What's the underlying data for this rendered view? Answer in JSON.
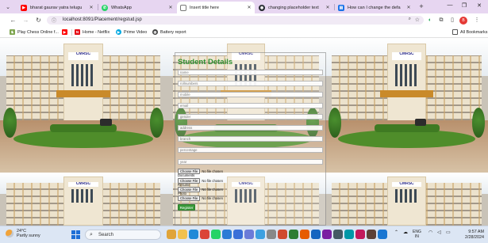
{
  "browser": {
    "tabs": [
      {
        "title": "bharat gaurav yatra telugu",
        "icon_color": "#ff0000",
        "active": false
      },
      {
        "title": "WhatsApp",
        "icon_color": "#25d366",
        "active": false
      },
      {
        "title": "Insert title here",
        "icon_color": "#6b6b6b",
        "active": true
      },
      {
        "title": "changing placeholder text",
        "icon_color": "#24292f",
        "active": false
      },
      {
        "title": "How can I change the defa",
        "icon_color": "#1a73e8",
        "active": false
      }
    ],
    "new_tab": "+",
    "window_controls": {
      "minimize": "—",
      "restore": "❐",
      "close": "✕"
    },
    "address": "localhost:8091/Placement/regstud.jsp",
    "bookmarks": {
      "all_label": "All Bookmarks",
      "items": [
        {
          "label": "Play Chess Online f...",
          "icon_color": "#7fa650"
        },
        {
          "label": "Home - Netflix",
          "icon_color": "#e50914"
        },
        {
          "label": "Prime Video",
          "icon_color": "#00a8e1"
        },
        {
          "label": "Battery report",
          "icon_color": "#444444"
        }
      ]
    }
  },
  "page": {
    "college_sign": "CMRSC",
    "form": {
      "title": "Student Details",
      "fields": [
        {
          "placeholder": "name"
        },
        {
          "placeholder": "rollnumbers"
        },
        {
          "placeholder": "mobile"
        },
        {
          "placeholder": "email"
        },
        {
          "placeholder": "gender"
        },
        {
          "placeholder": "address"
        },
        {
          "placeholder": "branch"
        },
        {
          "placeholder": "percentage"
        },
        {
          "placeholder": "year"
        }
      ],
      "file_inputs": [
        {
          "button": "Choose File",
          "status": "No file chosen",
          "label": "Documents"
        },
        {
          "button": "Choose File",
          "status": "No file chosen",
          "label": ""
        },
        {
          "button": "Choose File",
          "status": "No file chosen",
          "label": "Resume"
        },
        {
          "button": "Choose File",
          "status": "No file chosen",
          "label": "Photo"
        }
      ],
      "submit_label": "Register"
    }
  },
  "taskbar": {
    "weather": {
      "temp": "24°C",
      "condition": "Partly sunny"
    },
    "search_label": "Search",
    "language": {
      "line1": "ENG",
      "line2": "IN"
    },
    "clock": {
      "time": "9:57 AM",
      "date": "2/28/2024"
    },
    "apps": [
      {
        "name": "widgets",
        "color": "#e0a43a"
      },
      {
        "name": "file-explorer",
        "color": "#f2c14e"
      },
      {
        "name": "browser-edge",
        "color": "#1f8ad8"
      },
      {
        "name": "chrome",
        "color": "#db4437"
      },
      {
        "name": "whatsapp",
        "color": "#25d366"
      },
      {
        "name": "vscode",
        "color": "#2b7bd6"
      },
      {
        "name": "mail",
        "color": "#3a6fd8"
      },
      {
        "name": "store",
        "color": "#6b7bd8"
      },
      {
        "name": "app",
        "color": "#3da0e0"
      },
      {
        "name": "app",
        "color": "#888888"
      },
      {
        "name": "app",
        "color": "#d04a2f"
      },
      {
        "name": "app",
        "color": "#2e7d32"
      },
      {
        "name": "app",
        "color": "#e65c00"
      },
      {
        "name": "app",
        "color": "#1565c0"
      },
      {
        "name": "app",
        "color": "#7b1fa2"
      },
      {
        "name": "app",
        "color": "#455a64"
      },
      {
        "name": "app",
        "color": "#0097a7"
      },
      {
        "name": "app",
        "color": "#c2185b"
      },
      {
        "name": "app",
        "color": "#5d4037"
      },
      {
        "name": "app",
        "color": "#1976d2"
      }
    ]
  }
}
